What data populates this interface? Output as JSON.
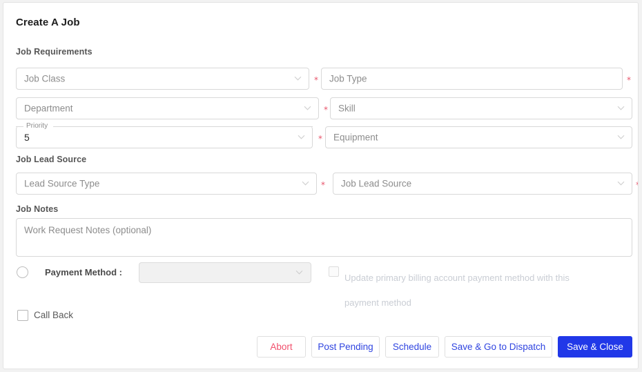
{
  "page": {
    "title": "Create A Job"
  },
  "sections": {
    "requirements": "Job Requirements",
    "lead_source": "Job Lead Source",
    "notes": "Job Notes"
  },
  "fields": {
    "job_class": {
      "placeholder": "Job Class",
      "value": "",
      "required": true,
      "icon": "chevron-down-icon"
    },
    "job_type": {
      "placeholder": "Job Type",
      "value": "",
      "required": true,
      "icon": ""
    },
    "department": {
      "placeholder": "Department",
      "value": "",
      "required": true,
      "icon": "chevron-down-icon"
    },
    "skill": {
      "placeholder": "Skill",
      "value": "",
      "required": false,
      "icon": "chevron-down-icon"
    },
    "priority": {
      "label": "Priority",
      "value": "5",
      "required": true,
      "icon": "chevron-down-icon"
    },
    "equipment": {
      "placeholder": "Equipment",
      "value": "",
      "required": false,
      "icon": "chevron-down-icon"
    },
    "lead_source_type": {
      "placeholder": "Lead Source Type",
      "value": "",
      "required": true,
      "icon": "chevron-down-icon"
    },
    "job_lead_source": {
      "placeholder": "Job Lead Source",
      "value": "",
      "required": true,
      "icon": "chevron-down-icon"
    },
    "job_notes": {
      "placeholder": "Work Request Notes (optional)",
      "value": ""
    }
  },
  "payment": {
    "radio_label": "",
    "label": "Payment Method :",
    "select_value": "",
    "select_icon": "chevron-down-icon",
    "update_billing_label": "Update primary billing account payment method with this payment method",
    "update_billing_checked": false,
    "disabled": true
  },
  "call_back": {
    "label": "Call Back",
    "checked": false
  },
  "buttons": [
    {
      "label": "Abort",
      "style": "danger"
    },
    {
      "label": "Post Pending",
      "style": "outline"
    },
    {
      "label": "Schedule",
      "style": "outline"
    },
    {
      "label": "Save & Go to Dispatch",
      "style": "outline"
    },
    {
      "label": "Save & Close",
      "style": "primary"
    }
  ],
  "colors": {
    "primary_blue": "#2138e8",
    "danger_red": "#f1506c",
    "required_star": "#e8546b",
    "border": "#d8d8d8",
    "placeholder": "#8d8d8d",
    "disabled_text": "#c9cdd4"
  },
  "star": "*"
}
